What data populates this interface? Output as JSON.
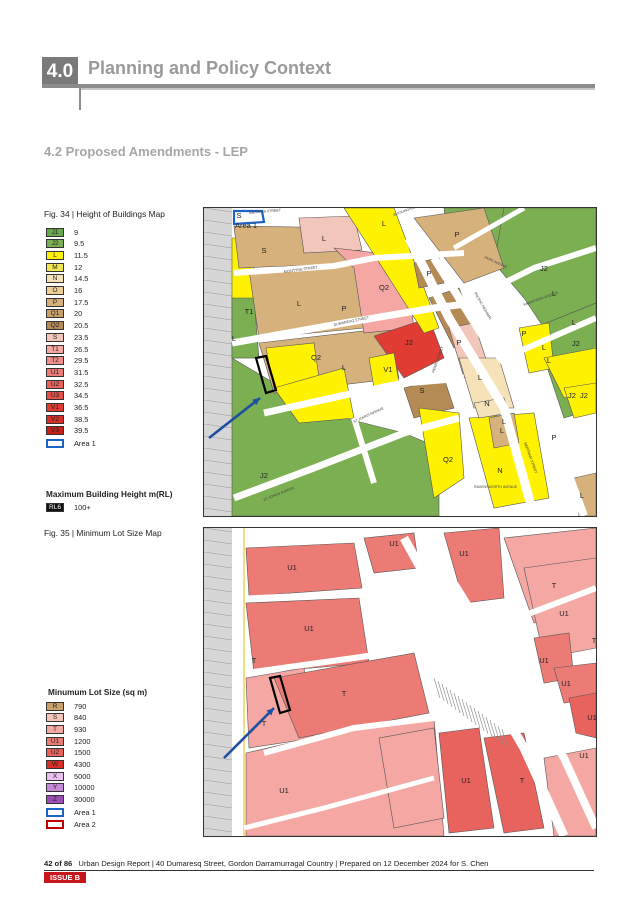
{
  "header": {
    "section_number": "4.0",
    "section_title": "Planning and Policy Context"
  },
  "subsection_title": "4.2 Proposed Amendments - LEP",
  "fig34": {
    "caption": "Fig. 34 | Height of Buildings Map",
    "legend": [
      {
        "code": "J1",
        "value": "9",
        "color": "#6aa84f"
      },
      {
        "code": "J2",
        "value": "9.5",
        "color": "#7cae52"
      },
      {
        "code": "L",
        "value": "11.5",
        "color": "#fff200"
      },
      {
        "code": "M",
        "value": "12",
        "color": "#f1e64f"
      },
      {
        "code": "N",
        "value": "14.5",
        "color": "#f5e2b8"
      },
      {
        "code": "O",
        "value": "16",
        "color": "#eccf97"
      },
      {
        "code": "P",
        "value": "17.5",
        "color": "#d6b17b"
      },
      {
        "code": "Q1",
        "value": "20",
        "color": "#c7a06a"
      },
      {
        "code": "Q2",
        "value": "20.5",
        "color": "#b48a55"
      },
      {
        "code": "S",
        "value": "23.5",
        "color": "#f2c6bb"
      },
      {
        "code": "T1",
        "value": "26.5",
        "color": "#f4a7a3"
      },
      {
        "code": "T2",
        "value": "29.5",
        "color": "#f08f8a"
      },
      {
        "code": "U1",
        "value": "31.5",
        "color": "#ec7b75"
      },
      {
        "code": "U2",
        "value": "32.5",
        "color": "#e8635d"
      },
      {
        "code": "U3",
        "value": "34.5",
        "color": "#e35049"
      },
      {
        "code": "V1",
        "value": "36.5",
        "color": "#e03c34"
      },
      {
        "code": "V2",
        "value": "38.5",
        "color": "#d82e26"
      },
      {
        "code": "V3",
        "value": "39.5",
        "color": "#c82019"
      }
    ],
    "area1_label": "Area 1",
    "max_height_heading": "Maximum Building Height m(RL)",
    "rl_code": "RL6",
    "rl_value": "100+",
    "map_labels": [
      "S",
      "Area 1",
      "L",
      "P",
      "S",
      "L",
      "P",
      "Q2",
      "T1",
      "L",
      "P",
      "L",
      "Q2",
      "J2",
      "P",
      "L",
      "V1",
      "S",
      "L",
      "N",
      "Q2",
      "N",
      "L",
      "P",
      "L",
      "J2",
      "L",
      "L",
      "J2",
      "J2",
      "J2",
      "L",
      "L",
      "L",
      "P",
      "J2"
    ],
    "street_labels": [
      "MERRIWA STREET",
      "MCINTYRE STREET",
      "DUMARESQ STREET",
      "HENRY STREET",
      "ST JOHNS AVENUE",
      "PARK AVENUE",
      "WHARTOON AVENUE",
      "PACIFIC HIGHWAY",
      "BUCKINGHAM STREET",
      "RAVENSWORTH AVENUE",
      "BERTRAM STREET",
      "ST JOHNS AVENUE"
    ]
  },
  "fig35": {
    "caption": "Fig. 35 | Minimum Lot Size Map",
    "legend_heading": "Minumum Lot Size (sq m)",
    "legend": [
      {
        "code": "R",
        "value": "790",
        "color": "#c7a06a"
      },
      {
        "code": "S",
        "value": "840",
        "color": "#f2c6bb"
      },
      {
        "code": "T",
        "value": "930",
        "color": "#f4a7a3"
      },
      {
        "code": "U1",
        "value": "1200",
        "color": "#ec7b75"
      },
      {
        "code": "U2",
        "value": "1500",
        "color": "#e8635d"
      },
      {
        "code": "W",
        "value": "4300",
        "color": "#d82e26"
      },
      {
        "code": "X",
        "value": "5000",
        "color": "#e9c1ee"
      },
      {
        "code": "Y",
        "value": "10000",
        "color": "#c58ad4"
      },
      {
        "code": "Z",
        "value": "30000",
        "color": "#9b4fb3"
      }
    ],
    "area1_label": "Area 1",
    "area2_label": "Area 2",
    "map_labels": [
      "U1",
      "U1",
      "U1",
      "U1",
      "T",
      "T",
      "U1",
      "T",
      "U1",
      "T",
      "T",
      "U1",
      "U1",
      "U1",
      "U1",
      "T",
      "U1"
    ]
  },
  "footer": {
    "page": "42 of 86",
    "text": "Urban Design Report  |  40 Dumaresq Street, Gordon Darramurragal Country  |  Prepared on 12 December 2024 for S. Chen",
    "issue": "ISSUE B"
  },
  "colors": {
    "arrow": "#1f4fa0",
    "area1": "#1e63c4",
    "area2": "#c00000",
    "issue_bg": "#c4161c"
  }
}
